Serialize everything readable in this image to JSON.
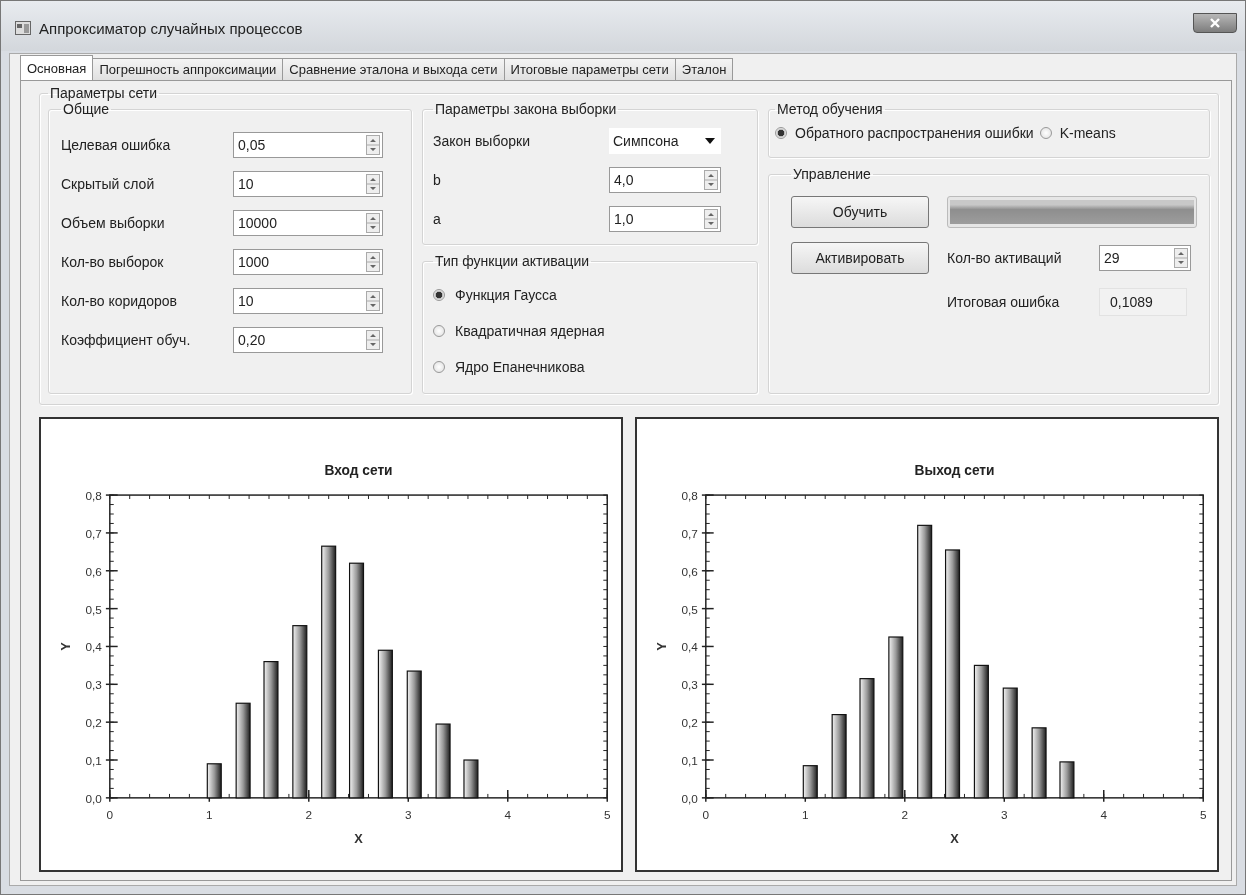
{
  "window": {
    "title": "Аппроксиматор случайных процессов"
  },
  "tabs": [
    {
      "label": "Основная",
      "selected": true
    },
    {
      "label": "Погрешность аппроксимации",
      "selected": false
    },
    {
      "label": "Сравнение эталона и выхода сети",
      "selected": false
    },
    {
      "label": "Итоговые параметры сети",
      "selected": false
    },
    {
      "label": "Эталон",
      "selected": false
    }
  ],
  "network_params": {
    "title": "Параметры сети",
    "general": {
      "title": "Общие",
      "fields": [
        {
          "label": "Целевая ошибка",
          "value": "0,05"
        },
        {
          "label": "Скрытый слой",
          "value": "10"
        },
        {
          "label": "Объем выборки",
          "value": "10000"
        },
        {
          "label": "Кол-во выборок",
          "value": "1000"
        },
        {
          "label": "Кол-во коридоров",
          "value": "10"
        },
        {
          "label": "Коэффициент обуч.",
          "value": "0,20"
        }
      ]
    },
    "sampling_law": {
      "title": "Параметры закона выборки",
      "law": {
        "label": "Закон выборки",
        "value": "Симпсона"
      },
      "fields": [
        {
          "label": "b",
          "value": "4,0"
        },
        {
          "label": "a",
          "value": "1,0"
        }
      ]
    },
    "activation": {
      "title": "Тип функции активации",
      "options": [
        {
          "label": "Функция Гаусса",
          "selected": true
        },
        {
          "label": "Квадратичная ядерная",
          "selected": false
        },
        {
          "label": "Ядро Епанечникова",
          "selected": false
        }
      ]
    },
    "training_method": {
      "title": "Метод обучения",
      "options": [
        {
          "label": "Обратного распространения ошибки",
          "selected": true
        },
        {
          "label": "K-means",
          "selected": false
        }
      ]
    },
    "control": {
      "title": "Управление",
      "train_button": "Обучить",
      "progress": {
        "level": 1
      },
      "activate_button": "Активировать",
      "activations": {
        "label": "Кол-во активаций",
        "value": "29"
      },
      "final_error": {
        "label": "Итоговая ошибка",
        "value": "0,1089"
      }
    }
  },
  "charts": [
    {
      "chart_data": {
        "type": "bar",
        "title": "Вход сети",
        "xlabel": "X",
        "ylabel": "Y",
        "x": [
          1.05,
          1.34,
          1.62,
          1.91,
          2.2,
          2.48,
          2.77,
          3.06,
          3.35,
          3.63
        ],
        "values": [
          0.09,
          0.25,
          0.36,
          0.455,
          0.665,
          0.62,
          0.39,
          0.335,
          0.195,
          0.1
        ],
        "xlim": [
          0,
          5
        ],
        "ylim": [
          0,
          0.8
        ],
        "xticks": [
          0,
          1,
          2,
          3,
          4,
          5
        ],
        "yticks": [
          {
            "value": 0,
            "label": "0,0"
          },
          {
            "value": 0.1,
            "label": "0,1"
          },
          {
            "value": 0.2,
            "label": "0,2"
          },
          {
            "value": 0.3,
            "label": "0,3"
          },
          {
            "value": 0.4,
            "label": "0,4"
          },
          {
            "value": 0.5,
            "label": "0,5"
          },
          {
            "value": 0.6,
            "label": "0,6"
          },
          {
            "value": 0.7,
            "label": "0,7"
          },
          {
            "value": 0.8,
            "label": "0,8"
          }
        ]
      }
    },
    {
      "chart_data": {
        "type": "bar",
        "title": "Выход сети",
        "xlabel": "X",
        "ylabel": "Y",
        "x": [
          1.05,
          1.34,
          1.62,
          1.91,
          2.2,
          2.48,
          2.77,
          3.06,
          3.35,
          3.63
        ],
        "values": [
          0.085,
          0.22,
          0.315,
          0.425,
          0.72,
          0.655,
          0.35,
          0.29,
          0.185,
          0.095
        ],
        "xlim": [
          0,
          5
        ],
        "ylim": [
          0,
          0.8
        ],
        "xticks": [
          0,
          1,
          2,
          3,
          4,
          5
        ],
        "yticks": [
          {
            "value": 0,
            "label": "0,0"
          },
          {
            "value": 0.1,
            "label": "0,1"
          },
          {
            "value": 0.2,
            "label": "0,2"
          },
          {
            "value": 0.3,
            "label": "0,3"
          },
          {
            "value": 0.4,
            "label": "0,4"
          },
          {
            "value": 0.5,
            "label": "0,5"
          },
          {
            "value": 0.6,
            "label": "0,6"
          },
          {
            "value": 0.7,
            "label": "0,7"
          },
          {
            "value": 0.8,
            "label": "0,8"
          }
        ]
      }
    }
  ]
}
